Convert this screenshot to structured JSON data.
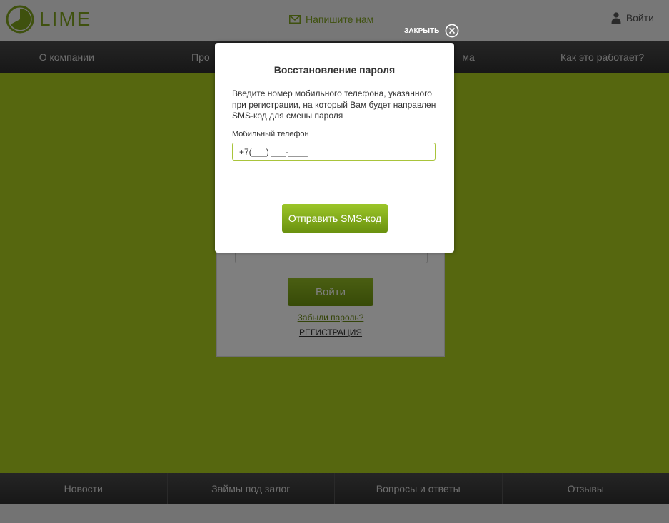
{
  "header": {
    "logo_text": "LIME",
    "contact_label": "Напишите нам",
    "login_label": "Войти"
  },
  "top_nav": {
    "items": [
      "О компании",
      "Про",
      "",
      "ма",
      "Как это работает?"
    ]
  },
  "login_form": {
    "submit_label": "Войти",
    "forgot_password": "Забыли пароль?",
    "register": "РЕГИСТРАЦИЯ"
  },
  "bottom_nav": {
    "items": [
      "Новости",
      "Займы под залог",
      "Вопросы и ответы",
      "Отзывы"
    ]
  },
  "modal": {
    "close_label": "ЗАКРЫТЬ",
    "title": "Восстановление пароля",
    "description_lines": [
      "Введите номер мобильного телефона, указанного",
      "при регистрации, на который Вам будет направлен",
      "SMS-код для смены пароля"
    ],
    "phone_label": "Мобильный телефон",
    "phone_value": "+7(___) ___-____",
    "send_button": "Отправить SMS-код"
  },
  "colors": {
    "accent": "#7fa21d",
    "main_background": "#adcf1e",
    "nav_background": "#3c3c3c",
    "button_green": "#86ad1c"
  },
  "icons": {
    "logo": "lime-logo-icon",
    "mail": "envelope-icon",
    "user": "user-icon",
    "close": "close-circle-icon"
  }
}
